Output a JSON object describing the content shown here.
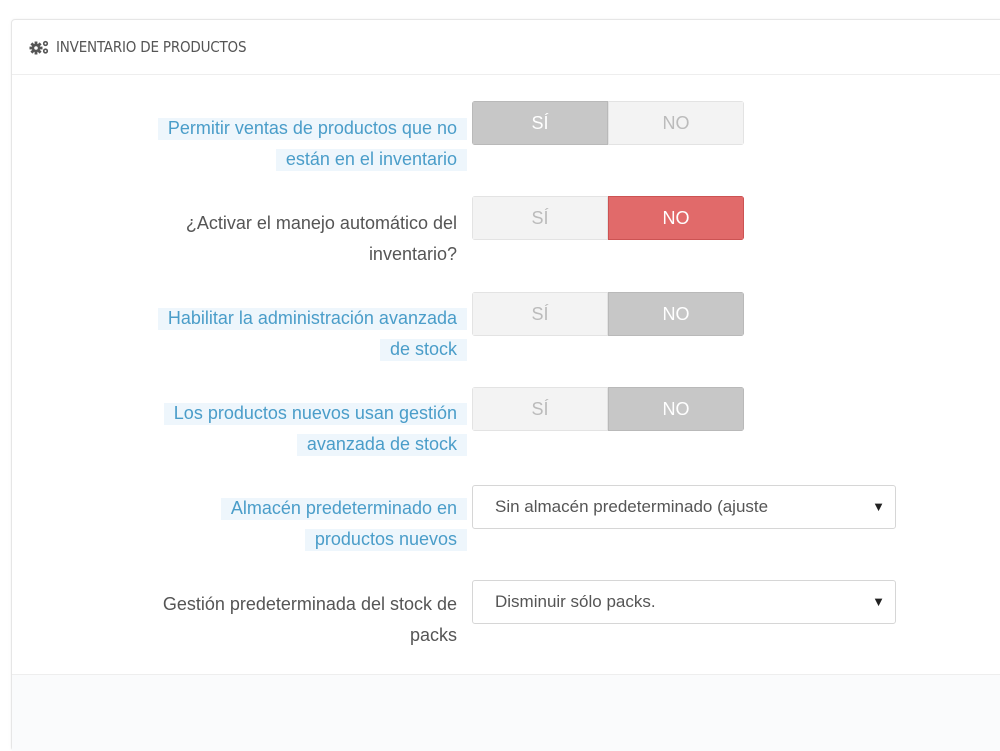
{
  "panel": {
    "title": "INVENTARIO DE PRODUCTOS",
    "icon": "cogs-icon"
  },
  "fields": [
    {
      "label_line1": "Permitir ventas de productos que no",
      "label_line2": "están en el inventario",
      "yes": "SÍ",
      "no": "NO",
      "value": "yes"
    },
    {
      "label_line1": "¿Activar el manejo automático del",
      "label_line2": "inventario?",
      "yes": "SÍ",
      "no": "NO",
      "value": "no"
    },
    {
      "label_line1": "Habilitar la administración avanzada",
      "label_line2": "de stock",
      "yes": "SÍ",
      "no": "NO",
      "value": "no"
    },
    {
      "label_line1": "Los productos nuevos usan gestión",
      "label_line2": "avanzada de stock",
      "yes": "SÍ",
      "no": "NO",
      "value": "no"
    },
    {
      "label_line1": "Almacén predeterminado en",
      "label_line2": "productos nuevos",
      "selected": "Sin almacén predeterminado (ajuste"
    },
    {
      "label_line1": "Gestión predeterminada del stock de",
      "label_line2": "packs",
      "selected": "Disminuir sólo packs."
    }
  ],
  "colors": {
    "active_no_red": "#e16a6a",
    "active_grey": "#c7c7c7",
    "hint_text": "#4a9dc9",
    "hint_bg": "#eef6fc"
  }
}
